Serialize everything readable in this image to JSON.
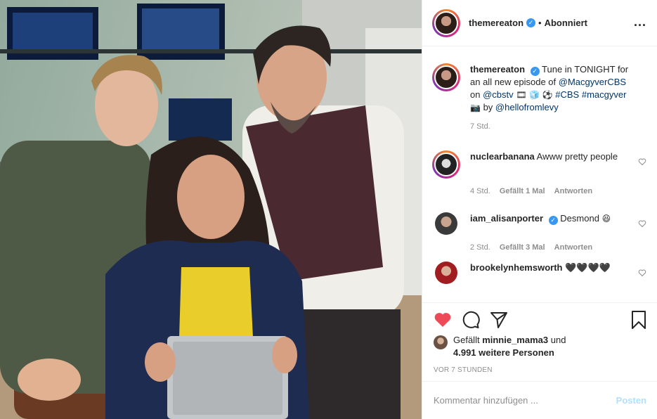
{
  "header": {
    "username": "themereaton",
    "verified_mark": "✓",
    "separator": "•",
    "follow_status": "Abonniert",
    "more_label": "..."
  },
  "caption": {
    "username": "themereaton",
    "text_1": "Tune in TONIGHT for an all new episode of ",
    "mention_1": "@MacgyverCBS",
    "text_2": " on ",
    "mention_2": "@cbstv",
    "emoji_1": "🎞",
    "emoji_2": "🧊",
    "emoji_3": "⚽",
    "hashtag_1": "#CBS",
    "hashtag_2": "#macgyver",
    "emoji_4": "📷",
    "text_3": " by ",
    "mention_3": "@hellofromlevy",
    "time": "7 Std."
  },
  "comments": [
    {
      "username": "nuclearbanana",
      "text": "Awww pretty people",
      "time": "4 Std.",
      "likes": "Gefällt 1 Mal",
      "reply": "Antworten"
    },
    {
      "username": "iam_alisanporter",
      "text": "Desmond",
      "emoji": "😆",
      "time": "2 Std.",
      "likes": "Gefällt 3 Mal",
      "reply": "Antworten"
    },
    {
      "username": "brookelynhemsworth",
      "text": "🖤🖤🖤🖤"
    }
  ],
  "likes": {
    "prefix": "Gefällt ",
    "user": "minnie_mama3",
    "mid": " und",
    "others": "4.991 weitere Personen"
  },
  "timestamp": "VOR 7 STUNDEN",
  "add_comment": {
    "placeholder": "Kommentar hinzufügen ...",
    "post_label": "Posten"
  },
  "icons": {
    "like": "heart-filled-icon",
    "comment": "comment-bubble-icon",
    "share": "paper-plane-icon",
    "save": "bookmark-icon",
    "more": "more-options-icon"
  },
  "colors": {
    "like_red": "#ed4956",
    "verified_blue": "#3897f0",
    "link_blue": "#003569",
    "muted": "#8e8e8e",
    "post_button": "#b2dffc"
  }
}
